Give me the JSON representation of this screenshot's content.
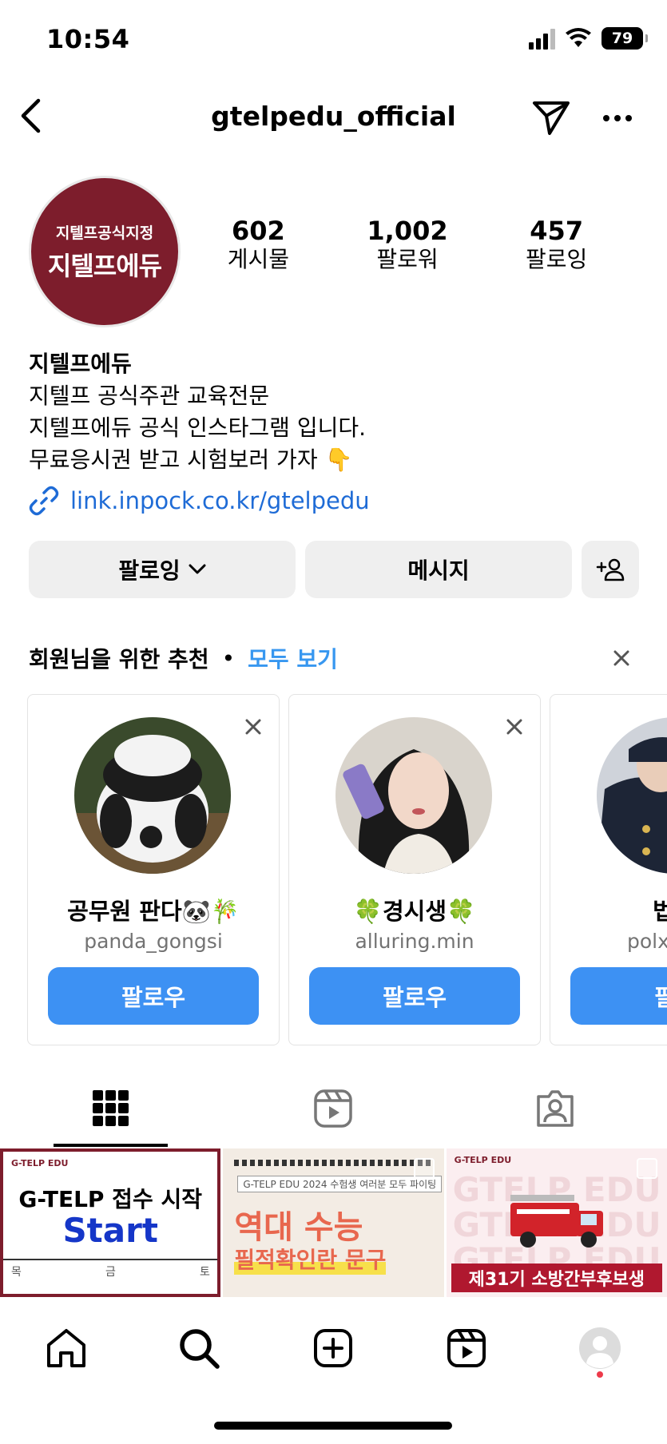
{
  "status": {
    "time": "10:54",
    "battery": "79"
  },
  "header": {
    "username": "gtelpedu_official"
  },
  "profile": {
    "avatar_line1": "지텔프공식지정",
    "avatar_line2": "지텔프에듀",
    "stats": [
      {
        "value": "602",
        "label": "게시물"
      },
      {
        "value": "1,002",
        "label": "팔로워"
      },
      {
        "value": "457",
        "label": "팔로잉"
      }
    ],
    "name": "지텔프에듀",
    "bio_lines": [
      "지텔프 공식주관 교육전문",
      "지텔프에듀 공식 인스타그램 입니다.",
      "무료응시권 받고 시험보러 가자 👇"
    ],
    "link": "link.inpock.co.kr/gtelpedu"
  },
  "actions": {
    "following_label": "팔로잉",
    "message_label": "메시지"
  },
  "suggestions": {
    "title": "회원님을 위한 추천",
    "see_all": "모두 보기",
    "cards": [
      {
        "name": "공무원 판다🐼🎋",
        "handle": "panda_gongsi",
        "follow_label": "팔로우"
      },
      {
        "name": "🍀경시생🍀",
        "handle": "alluring.min",
        "follow_label": "팔로우"
      },
      {
        "name": "법",
        "handle": "polx",
        "follow_label": "팔로"
      }
    ]
  },
  "posts": [
    {
      "tag": "G-TELP EDU",
      "headline": "G-TELP 접수 시작",
      "accent": "Start",
      "calendar_days": [
        "목",
        "금",
        "토"
      ]
    },
    {
      "tag": "G-TELP EDU  2024 수험생 여러분 모두 파이팅",
      "headline": "역대 수능",
      "sub": "필적확인란 문구"
    },
    {
      "tag": "G-TELP EDU",
      "watermark": "GTELP EDU GTELP EDU GTELP EDU",
      "banner": "제31기 소방간부후보생"
    }
  ],
  "colors": {
    "brand": "#7d1d2c",
    "follow_blue": "#3d91f3",
    "link_blue": "#1e6bd6"
  }
}
